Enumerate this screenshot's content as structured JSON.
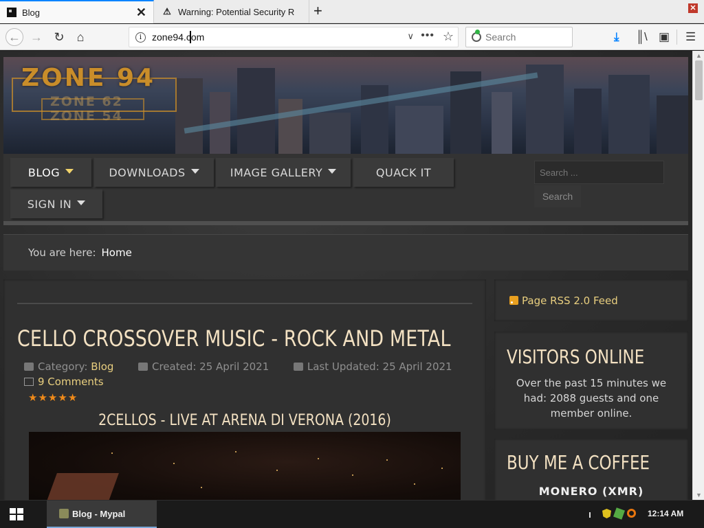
{
  "browser": {
    "tabs": [
      {
        "title": "Blog",
        "active": true
      },
      {
        "title": "Warning: Potential Security R",
        "active": false
      }
    ],
    "url": "zone94.com",
    "search_placeholder": "Search"
  },
  "site": {
    "logo_main": "ZONE 94",
    "logo_sub_1": "ZONE 62",
    "logo_sub_2": "ZONE 54",
    "menu": [
      {
        "label": "BLOG",
        "has_dropdown": true,
        "active": true
      },
      {
        "label": "DOWNLOADS",
        "has_dropdown": true
      },
      {
        "label": "IMAGE GALLERY",
        "has_dropdown": true
      },
      {
        "label": "QUACK IT",
        "has_dropdown": false
      },
      {
        "label": "SIGN IN",
        "has_dropdown": true
      }
    ],
    "search_placeholder": "Search ...",
    "search_button": "Search",
    "breadcrumb_prefix": "You are here:",
    "breadcrumb_home": "Home"
  },
  "article": {
    "title": "CELLO CROSSOVER MUSIC - ROCK AND METAL",
    "category_label": "Category:",
    "category": "Blog",
    "created": "Created: 25 April 2021",
    "updated": "Last Updated: 25 April 2021",
    "comments": "9 Comments",
    "rating_stars": 5,
    "subheading": "2CELLOS - LIVE AT ARENA DI VERONA (2016)"
  },
  "sidebar": {
    "rss": "Page RSS 2.0 Feed",
    "visitors_title": "VISITORS ONLINE",
    "visitors_text": "Over the past 15 minutes we had: 2088 guests and one member online.",
    "coffee_title": "BUY ME A COFFEE",
    "coffee_currency": "MONERO (XMR)"
  },
  "taskbar": {
    "app_label": "Blog - Mypal",
    "clock": "12:14 AM"
  },
  "colors": {
    "accent_link": "#e9cf7f",
    "heading": "#f3e1c2",
    "star": "#ef8a1a",
    "page_bg": "#2a2a2a"
  }
}
